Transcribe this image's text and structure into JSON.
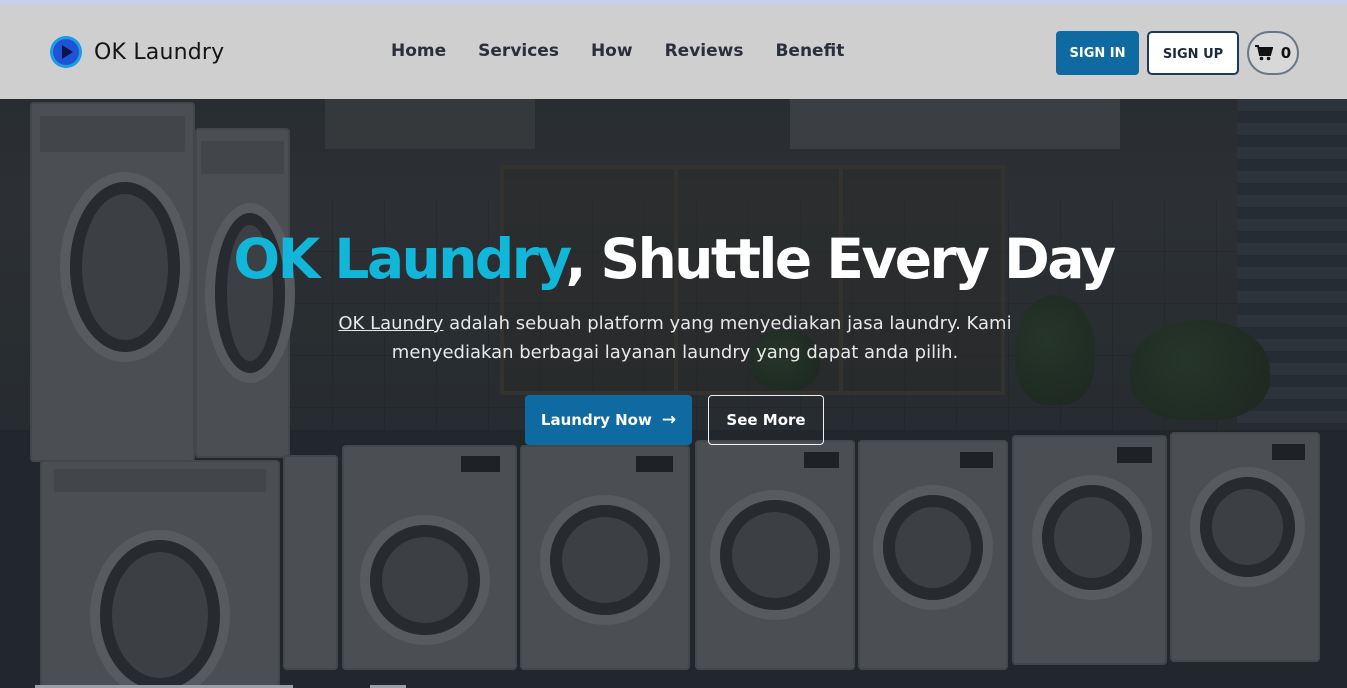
{
  "brand": {
    "name": "OK Laundry",
    "logo_icon": "play-circle-icon",
    "logo_color": "#1f53d6"
  },
  "nav": {
    "items": [
      {
        "label": "Home"
      },
      {
        "label": "Services"
      },
      {
        "label": "How"
      },
      {
        "label": "Reviews"
      },
      {
        "label": "Benefit"
      }
    ]
  },
  "auth": {
    "sign_in_label": "SIGN IN",
    "sign_up_label": "SIGN UP"
  },
  "cart": {
    "icon": "cart-icon",
    "count": "0"
  },
  "hero": {
    "title_accent": "OK Laundry",
    "title_rest": ", Shuttle Every Day",
    "desc_link": "OK Laundry",
    "desc_rest": " adalah sebuah platform yang menyediakan jasa laundry. Kami menyediakan berbagai layanan laundry yang dapat anda pilih.",
    "primary_button": "Laundry Now",
    "primary_button_icon": "arrow-right-icon",
    "secondary_button": "See More"
  },
  "colors": {
    "accent": "#12b6d9",
    "primary": "#0e6aa0",
    "header_bg": "#d6d6d6"
  }
}
